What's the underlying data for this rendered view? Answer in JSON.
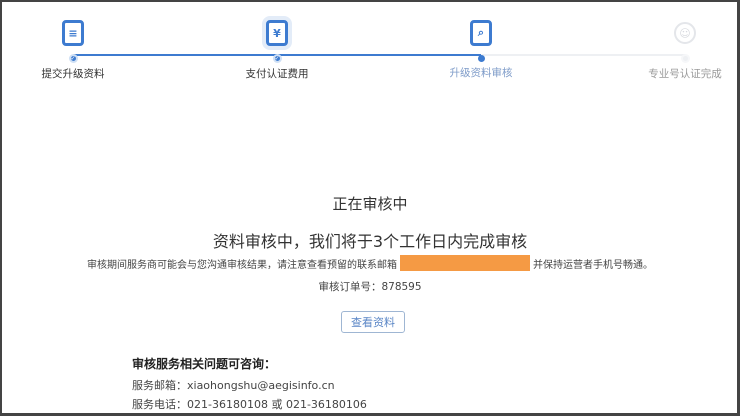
{
  "steps": [
    {
      "label": "提交升级资料",
      "icon": "document-icon",
      "state": "done"
    },
    {
      "label": "支付认证费用",
      "icon": "yen-icon",
      "state": "done"
    },
    {
      "label": "升级资料审核",
      "icon": "document-search-icon",
      "state": "current"
    },
    {
      "label": "专业号认证完成",
      "icon": "smile-icon",
      "state": "pending"
    }
  ],
  "main": {
    "status_title": "正在审核中",
    "subtitle": "资料审核中，我们将于3个工作日内完成审核",
    "notice_before": "审核期间服务商可能会与您沟通审核结果，请注意查看预留的联系邮箱",
    "notice_after": "并保持运营者手机号畅通。",
    "order_label": "审核订单号：",
    "order_number": "878595",
    "view_button": "查看资料"
  },
  "contact": {
    "heading": "审核服务相关问题可咨询：",
    "email_label": "服务邮箱：",
    "email": "xiaohongshu@aegisinfo.cn",
    "phone_label": "服务电话：",
    "phone": "021-36180108 或 021-36180106"
  },
  "colors": {
    "accent": "#3d7bd0",
    "redaction": "#f59a44"
  }
}
